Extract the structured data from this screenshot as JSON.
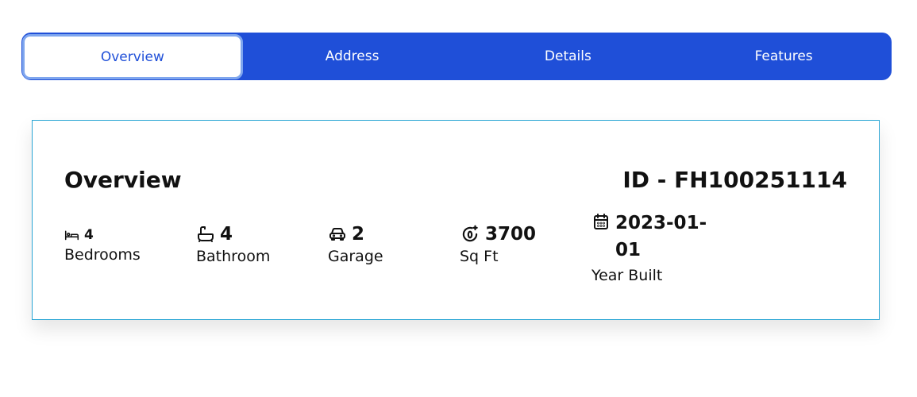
{
  "tabs": [
    {
      "label": "Overview"
    },
    {
      "label": "Address"
    },
    {
      "label": "Details"
    },
    {
      "label": "Features"
    }
  ],
  "overview": {
    "title": "Overview",
    "id_text": "ID - FH100251114",
    "stats": {
      "bedrooms": {
        "value": "4",
        "label": "Bedrooms",
        "icon": "bed-icon"
      },
      "bathroom": {
        "value": "4",
        "label": "Bathroom",
        "icon": "bathtub-icon"
      },
      "garage": {
        "value": "2",
        "label": "Garage",
        "icon": "car-icon"
      },
      "sqft": {
        "value": "3700",
        "label": "Sq Ft",
        "icon": "area-icon"
      },
      "year_built": {
        "value": "2023-01-01",
        "label": "Year Built",
        "icon": "calendar-icon"
      }
    }
  },
  "colors": {
    "accent": "#1f4fd8",
    "card_border": "#29a5d4"
  }
}
